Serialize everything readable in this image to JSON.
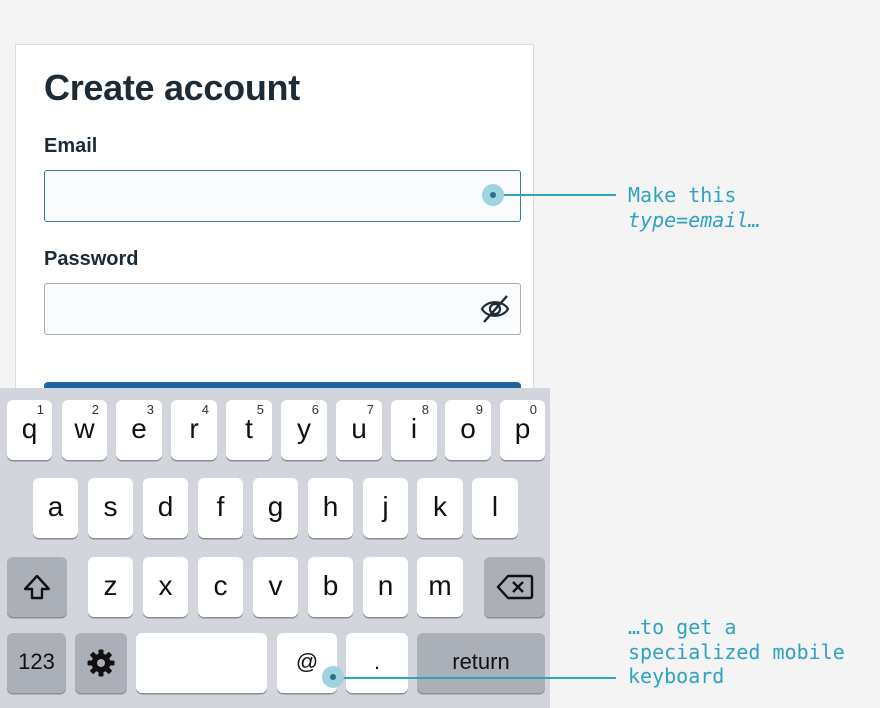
{
  "form": {
    "title": "Create account",
    "email_label": "Email",
    "email_value": "",
    "password_label": "Password",
    "password_value": ""
  },
  "keyboard": {
    "row1": [
      {
        "key": "q",
        "num": "1"
      },
      {
        "key": "w",
        "num": "2"
      },
      {
        "key": "e",
        "num": "3"
      },
      {
        "key": "r",
        "num": "4"
      },
      {
        "key": "t",
        "num": "5"
      },
      {
        "key": "y",
        "num": "6"
      },
      {
        "key": "u",
        "num": "7"
      },
      {
        "key": "i",
        "num": "8"
      },
      {
        "key": "o",
        "num": "9"
      },
      {
        "key": "p",
        "num": "0"
      }
    ],
    "row2": [
      "a",
      "s",
      "d",
      "f",
      "g",
      "h",
      "j",
      "k",
      "l"
    ],
    "row3": [
      "z",
      "x",
      "c",
      "v",
      "b",
      "n",
      "m"
    ],
    "numbers_key": "123",
    "at_key": "@",
    "dot_key": ".",
    "return_key": "return"
  },
  "annotations": {
    "top_line1": "Make this",
    "top_line2": "type=email…",
    "bottom_line1": "…to get a",
    "bottom_line2": "specialized mobile",
    "bottom_line3": "keyboard"
  },
  "colors": {
    "annotation": "#2ea3c2",
    "title_text": "#1d2b36",
    "button": "#1e64a0"
  },
  "icons": [
    "eye-slash-icon",
    "shift-icon",
    "backspace-icon",
    "gear-icon"
  ]
}
